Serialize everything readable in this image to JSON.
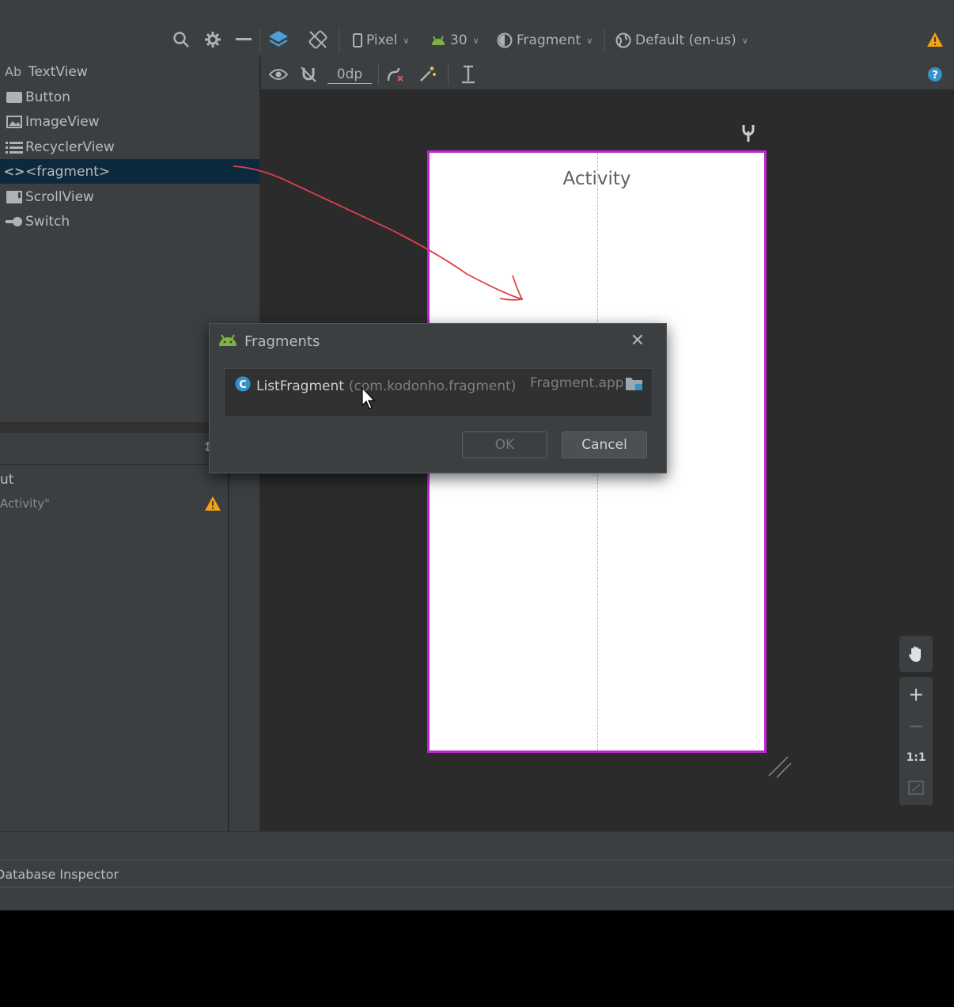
{
  "toolbar": {
    "device": "Pixel",
    "api_level": "30",
    "theme": "Fragment",
    "locale": "Default (en-us)",
    "margin": "0dp"
  },
  "palette": {
    "items": [
      {
        "prefix": "Ab",
        "label": "TextView"
      },
      {
        "label": "Button"
      },
      {
        "label": "ImageView"
      },
      {
        "label": "RecyclerView"
      },
      {
        "label": "<fragment>"
      },
      {
        "label": "ScrollView"
      },
      {
        "label": "Switch"
      }
    ]
  },
  "component_tree": {
    "row1": "ut",
    "row2": "Activity\""
  },
  "design": {
    "phone_text": "Activity",
    "accent_border": "#c026d3"
  },
  "dialog": {
    "title": "Fragments",
    "item_name": "ListFragment",
    "item_package": "(com.kodonho.fragment)",
    "item_module": "Fragment.app",
    "ok_label": "OK",
    "cancel_label": "Cancel"
  },
  "zoom": {
    "one_to_one": "1:1"
  },
  "status": {
    "bottom_tab": "Database Inspector"
  }
}
